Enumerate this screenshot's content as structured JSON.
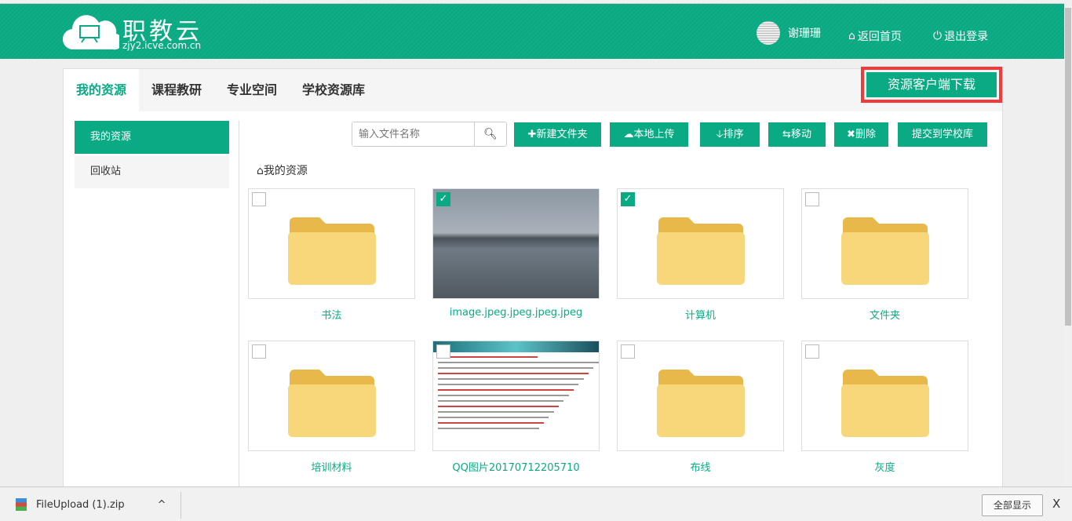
{
  "header": {
    "brand": "职教云",
    "domain": "zjy2.icve.com.cn",
    "user_name": "谢珊珊",
    "home_link": "返回首页",
    "logout_link": "退出登录"
  },
  "tabs": [
    {
      "label": "我的资源"
    },
    {
      "label": "课程教研"
    },
    {
      "label": "专业空间"
    },
    {
      "label": "学校资源库"
    }
  ],
  "download_client": "资源客户端下载",
  "sidebar": [
    {
      "label": "我的资源"
    },
    {
      "label": "回收站"
    }
  ],
  "toolbar": {
    "search_placeholder": "输入文件名称",
    "new_folder": "新建文件夹",
    "upload": "本地上传",
    "sort": "排序",
    "move": "移动",
    "delete": "删除",
    "submit": "提交到学校库"
  },
  "breadcrumb": "我的资源",
  "items": [
    {
      "name": "书法",
      "type": "folder",
      "checked": false
    },
    {
      "name": "image.jpeg.jpeg.jpeg.jpeg",
      "type": "image",
      "checked": true
    },
    {
      "name": "计算机",
      "type": "folder",
      "checked": true
    },
    {
      "name": "文件夹",
      "type": "folder",
      "checked": false
    },
    {
      "name": "培训材料",
      "type": "folder",
      "checked": false
    },
    {
      "name": "QQ图片20170712205710",
      "type": "document",
      "checked": false
    },
    {
      "name": "布线",
      "type": "folder",
      "checked": false
    },
    {
      "name": "灰度",
      "type": "folder",
      "checked": false
    }
  ],
  "downloads": {
    "file": "FileUpload (1).zip",
    "show_all": "全部显示",
    "close": "X"
  }
}
